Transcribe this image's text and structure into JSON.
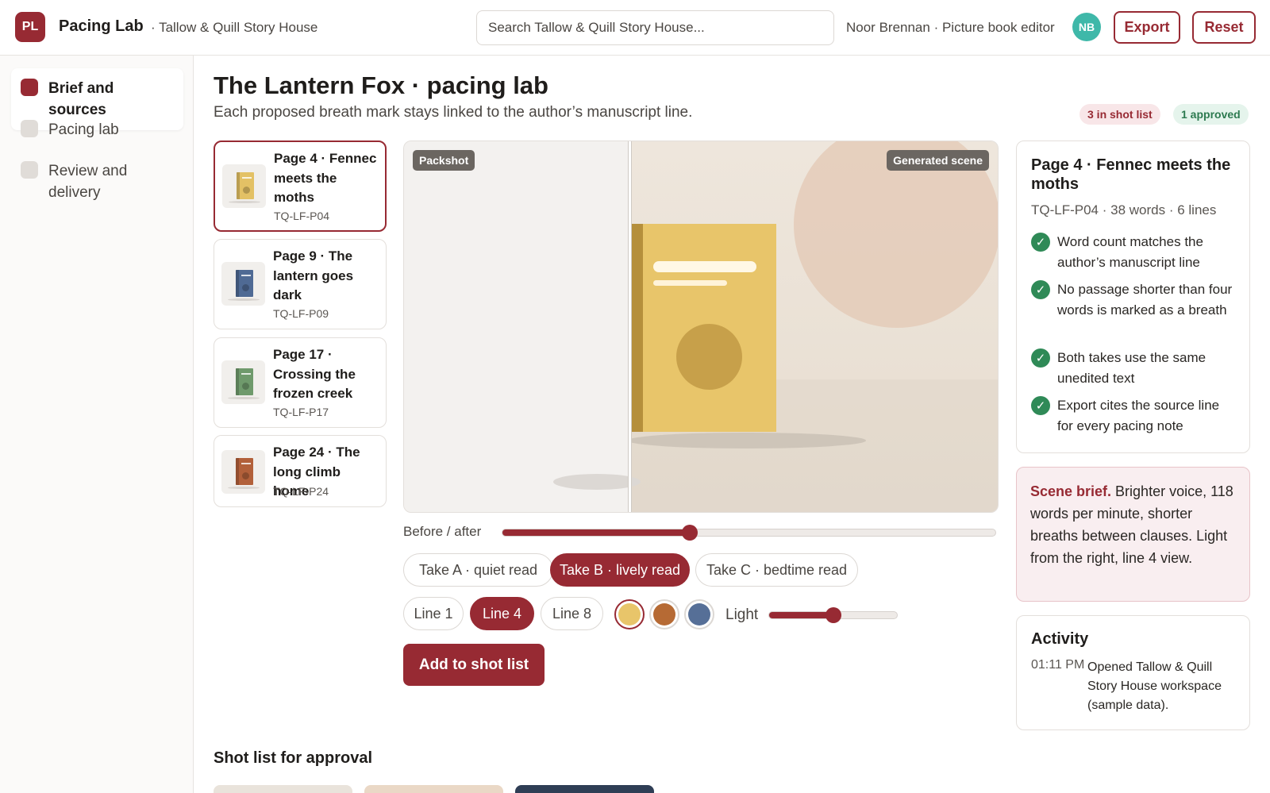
{
  "app": {
    "logo_initials": "PL",
    "name": "Pacing Lab",
    "workspace": "· Tallow & Quill Story House"
  },
  "search": {
    "placeholder": "Search Tallow & Quill Story House..."
  },
  "user": {
    "label": "Noor Brennan · Picture book editor",
    "initials": "NB"
  },
  "header_actions": {
    "export": "Export",
    "reset": "Reset"
  },
  "sidebar": {
    "items": [
      {
        "label": "Brief and sources",
        "active": true
      },
      {
        "label": "Pacing lab",
        "active": false
      },
      {
        "label": "Review and delivery",
        "active": false
      }
    ]
  },
  "page": {
    "title": "The Lantern Fox · pacing lab",
    "subtitle": "Each proposed breath mark stays linked to the author’s manuscript line.",
    "badges": {
      "shot_list": "3 in shot list",
      "approved": "1 approved"
    }
  },
  "pages": [
    {
      "title": "Page 4 · Fennec meets the moths",
      "code": "TQ-LF-P04",
      "color": "#e3c165",
      "selected": true
    },
    {
      "title": "Page 9 · The lantern goes dark",
      "code": "TQ-LF-P09",
      "color": "#4f6a94",
      "selected": false
    },
    {
      "title": "Page 17 · Crossing the frozen creek",
      "code": "TQ-LF-P17",
      "color": "#6f9a6c",
      "selected": false
    },
    {
      "title": "Page 24 · The long climb home",
      "code": "TQ-LF-P24",
      "color": "#b2603a",
      "selected": false
    }
  ],
  "preview": {
    "left_label": "Packshot",
    "right_label": "Generated scene",
    "book_color": "#e8c56a"
  },
  "controls": {
    "before_after_label": "Before / after",
    "before_after_value": 0.38,
    "takes": [
      {
        "label": "Take A · quiet read",
        "active": false
      },
      {
        "label": "Take B · lively read",
        "active": true
      },
      {
        "label": "Take C · bedtime read",
        "active": false
      }
    ],
    "lines": [
      {
        "label": "Line 1",
        "active": false
      },
      {
        "label": "Line 4",
        "active": true
      },
      {
        "label": "Line 8",
        "active": false
      }
    ],
    "swatches": [
      {
        "color": "#e8c56a",
        "active": true
      },
      {
        "color": "#b66a34",
        "active": false
      },
      {
        "color": "#566f97",
        "active": false
      }
    ],
    "light_label": "Light",
    "light_value": 0.5,
    "add_button": "Add to shot list"
  },
  "details": {
    "title": "Page 4 · Fennec meets the moths",
    "meta": "TQ-LF-P04 · 38 words · 6 lines",
    "checks": [
      "Word count matches the author’s manuscript line",
      "No passage shorter than four words is marked as a breath",
      "Both takes use the same unedited text",
      "Export cites the source line for every pacing note"
    ],
    "check_icon": "check-icon"
  },
  "brief": {
    "label": "Scene brief.",
    "text": " Brighter voice, 118 words per minute, shorter breaths between clauses. Light from the right, line 4 view."
  },
  "activity": {
    "title": "Activity",
    "entries": [
      {
        "time": "01:11 PM",
        "text": "Opened Tallow & Quill Story House workspace (sample data)."
      }
    ]
  },
  "shot_list": {
    "title": "Shot list for approval",
    "thumbs": [
      {
        "color": "#e9e3db"
      },
      {
        "color": "#ead8c6"
      },
      {
        "color": "#2f3e55"
      }
    ]
  },
  "colors": {
    "accent": "#972a33",
    "success": "#2f8a57",
    "avatar": "#3fb8a9"
  }
}
